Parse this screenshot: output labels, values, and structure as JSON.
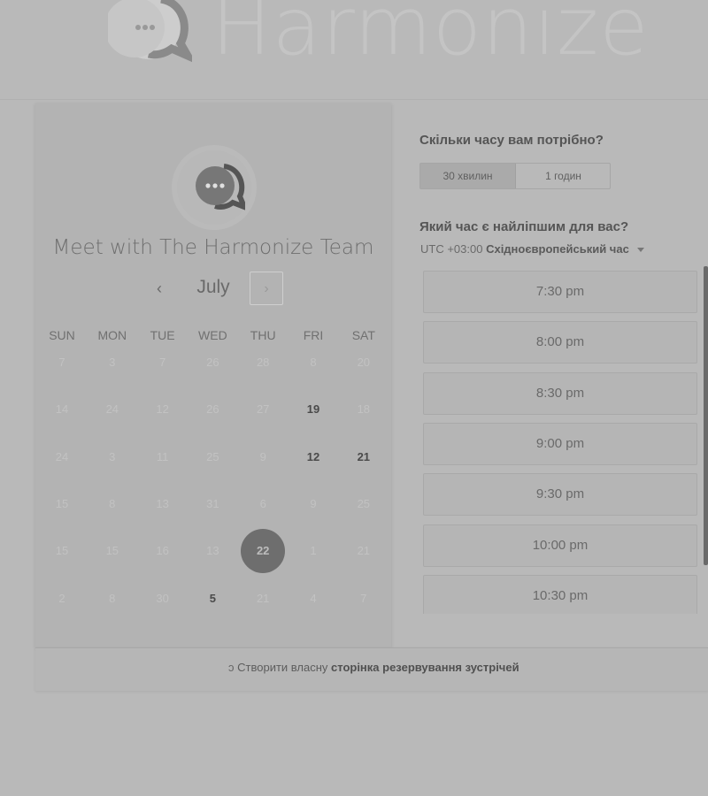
{
  "header": {
    "brand": "Harmonize"
  },
  "card": {
    "title": "Meet with The Harmonize Team",
    "month": "July",
    "prev": "‹",
    "next": "›",
    "weekdays": [
      "SUN",
      "MON",
      "TUE",
      "WED",
      "THU",
      "FRI",
      "SAT"
    ],
    "weeks": [
      [
        "7",
        "3",
        "7",
        "26",
        "28",
        "8",
        "20"
      ],
      [
        "14",
        "24",
        "12",
        "26",
        "27",
        "19",
        "18"
      ],
      [
        "24",
        "3",
        "11",
        "25",
        "9",
        "12",
        "21"
      ],
      [
        "15",
        "8",
        "13",
        "31",
        "6",
        "9",
        "25"
      ],
      [
        "15",
        "15",
        "16",
        "13",
        "22",
        "1",
        "21"
      ],
      [
        "2",
        "8",
        "30",
        "5",
        "21",
        "4",
        "7"
      ]
    ],
    "active_days": [
      "19",
      "12",
      "21",
      "5"
    ],
    "selected_day": "22"
  },
  "panel": {
    "duration_question": "Скільки часу вам потрібно?",
    "durations": [
      "30 хвилин",
      "1 годин"
    ],
    "time_question": "Який час є найліпшим для вас?",
    "tz_prefix": "UTC +03:00",
    "tz_name": "Східноєвропейський час",
    "slots": [
      "7:30 pm",
      "8:00 pm",
      "8:30 pm",
      "9:00 pm",
      "9:30 pm",
      "10:00 pm",
      "10:30 pm"
    ]
  },
  "footer": {
    "prefix": "Створити власну",
    "bold": "сторінка резервування зустрічей"
  }
}
